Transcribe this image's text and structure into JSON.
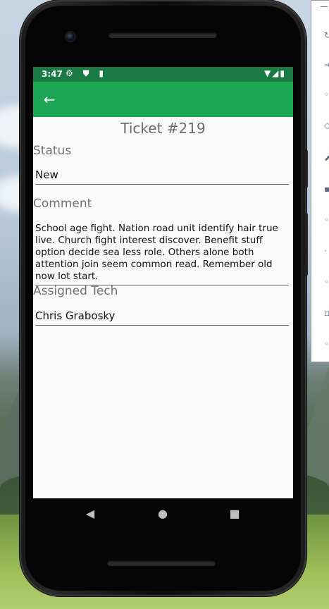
{
  "status_bar": {
    "time": "3:47",
    "left_icons": "⚙ ⛊ ▮",
    "right_icons": "▼◢▮"
  },
  "app_bar": {
    "back_icon": "←"
  },
  "ticket": {
    "title": "Ticket #219",
    "status_label": "Status",
    "status_value": "New",
    "comment_label": "Comment",
    "comment_value": "School age fight. Nation road unit identify hair true live. Church fight interest discover. Benefit stuff option decide sea less role. Others alone both attention join seem common read. Remember old now lot start.",
    "tech_label": "Assigned Tech",
    "tech_value": "Chris Grabosky"
  },
  "nav": {
    "back": "◀",
    "home": "●",
    "recents": "■"
  },
  "side_panel": {
    "icons": [
      "↻",
      "⇥",
      "◦",
      "◇",
      "⬈",
      "▪",
      "◦",
      "·",
      "◦",
      "▫",
      "◦"
    ]
  },
  "colors": {
    "status_bar": "#1a7a44",
    "app_bar": "#1aa653",
    "screen_bg": "#fafafa"
  }
}
